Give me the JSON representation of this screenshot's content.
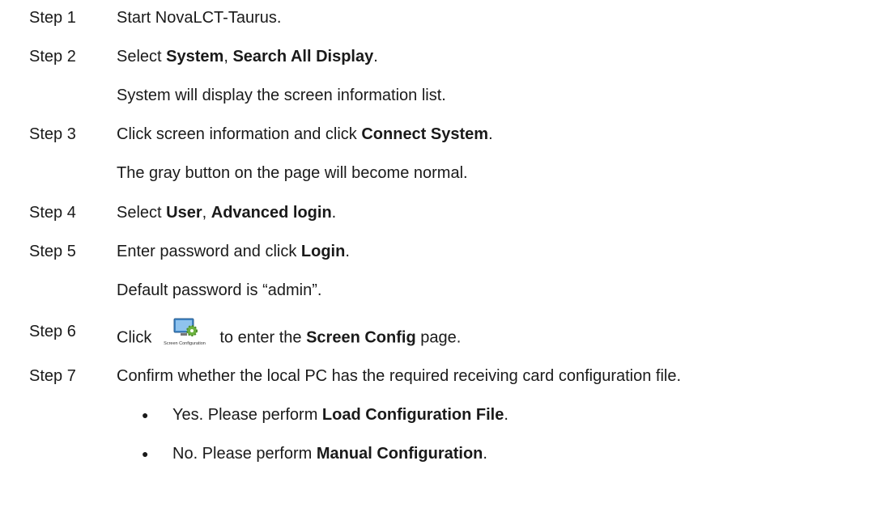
{
  "steps": [
    {
      "label": "Step 1",
      "parts": [
        {
          "t": "Start NovaLCT-Taurus."
        }
      ]
    },
    {
      "label": "Step 2",
      "parts": [
        {
          "t": "Select "
        },
        {
          "b": "System"
        },
        {
          "t": ", "
        },
        {
          "b": "Search All Display"
        },
        {
          "t": "."
        }
      ]
    },
    {
      "note": "System will display the screen information list."
    },
    {
      "label": "Step 3",
      "parts": [
        {
          "t": "Click screen information and click "
        },
        {
          "b": "Connect System"
        },
        {
          "t": "."
        }
      ]
    },
    {
      "note": "The gray button on the page will become normal."
    },
    {
      "label": "Step 4",
      "parts": [
        {
          "t": "Select "
        },
        {
          "b": "User"
        },
        {
          "t": ", "
        },
        {
          "b": "Advanced login"
        },
        {
          "t": "."
        }
      ]
    },
    {
      "label": "Step 5",
      "parts": [
        {
          "t": "Enter password and click "
        },
        {
          "b": "Login"
        },
        {
          "t": "."
        }
      ]
    },
    {
      "note": "Default password is “admin”."
    },
    {
      "label": "Step 6",
      "parts": [
        {
          "t": "Click"
        },
        {
          "icon": "screen-configuration-icon",
          "caption": "Screen Configuration"
        },
        {
          "t": "to enter the "
        },
        {
          "b": "Screen Config"
        },
        {
          "t": " page."
        }
      ]
    },
    {
      "label": "Step 7",
      "parts": [
        {
          "t": "Confirm whether the local PC has the required receiving card configuration file."
        }
      ]
    },
    {
      "bullet": "●",
      "parts": [
        {
          "t": "Yes. Please perform "
        },
        {
          "b": "Load Configuration File"
        },
        {
          "t": "."
        }
      ]
    },
    {
      "bullet": "●",
      "parts": [
        {
          "t": "No. Please perform "
        },
        {
          "b": "Manual Configuration"
        },
        {
          "t": "."
        }
      ]
    }
  ],
  "colors": {
    "text": "#1a1a1a",
    "icon_screen": "#3f86c7",
    "icon_gear": "#6cb33f"
  }
}
